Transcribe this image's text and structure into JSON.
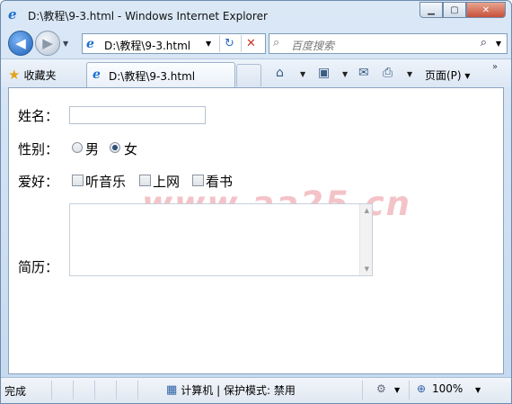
{
  "window": {
    "title": "D:\\教程\\9-3.html - Windows Internet Explorer",
    "min_glyph": "▁",
    "max_glyph": "▢",
    "close_glyph": "✕"
  },
  "nav": {
    "address": "D:\\教程\\9-3.html",
    "search_placeholder": "百度搜索"
  },
  "favorites": {
    "label": "收藏夹",
    "tab_title": "D:\\教程\\9-3.html",
    "page_menu": "页面(P) ▾"
  },
  "form": {
    "name_label": "姓名：",
    "gender_label": "性别：",
    "gender_options": [
      "男",
      "女"
    ],
    "gender_selected": "女",
    "hobby_label": "爱好：",
    "hobby_options": [
      "听音乐",
      "上网",
      "看书"
    ],
    "resume_label": "简历："
  },
  "watermark": "www.aa25.cn",
  "status": {
    "left": "完成",
    "zone": "计算机 | 保护模式: 禁用",
    "zoom": "100%"
  },
  "icons": {
    "back": "◀",
    "forward": "▶",
    "dropdown": "▼",
    "refresh": "↻",
    "stop": "✕",
    "search": "⌕",
    "star": "★",
    "home": "⌂",
    "rss": "▣",
    "mail": "✉",
    "print": "⎙",
    "computer": "▦",
    "zoom": "⊕",
    "chevron": "»",
    "up": "▲",
    "down": "▼"
  }
}
